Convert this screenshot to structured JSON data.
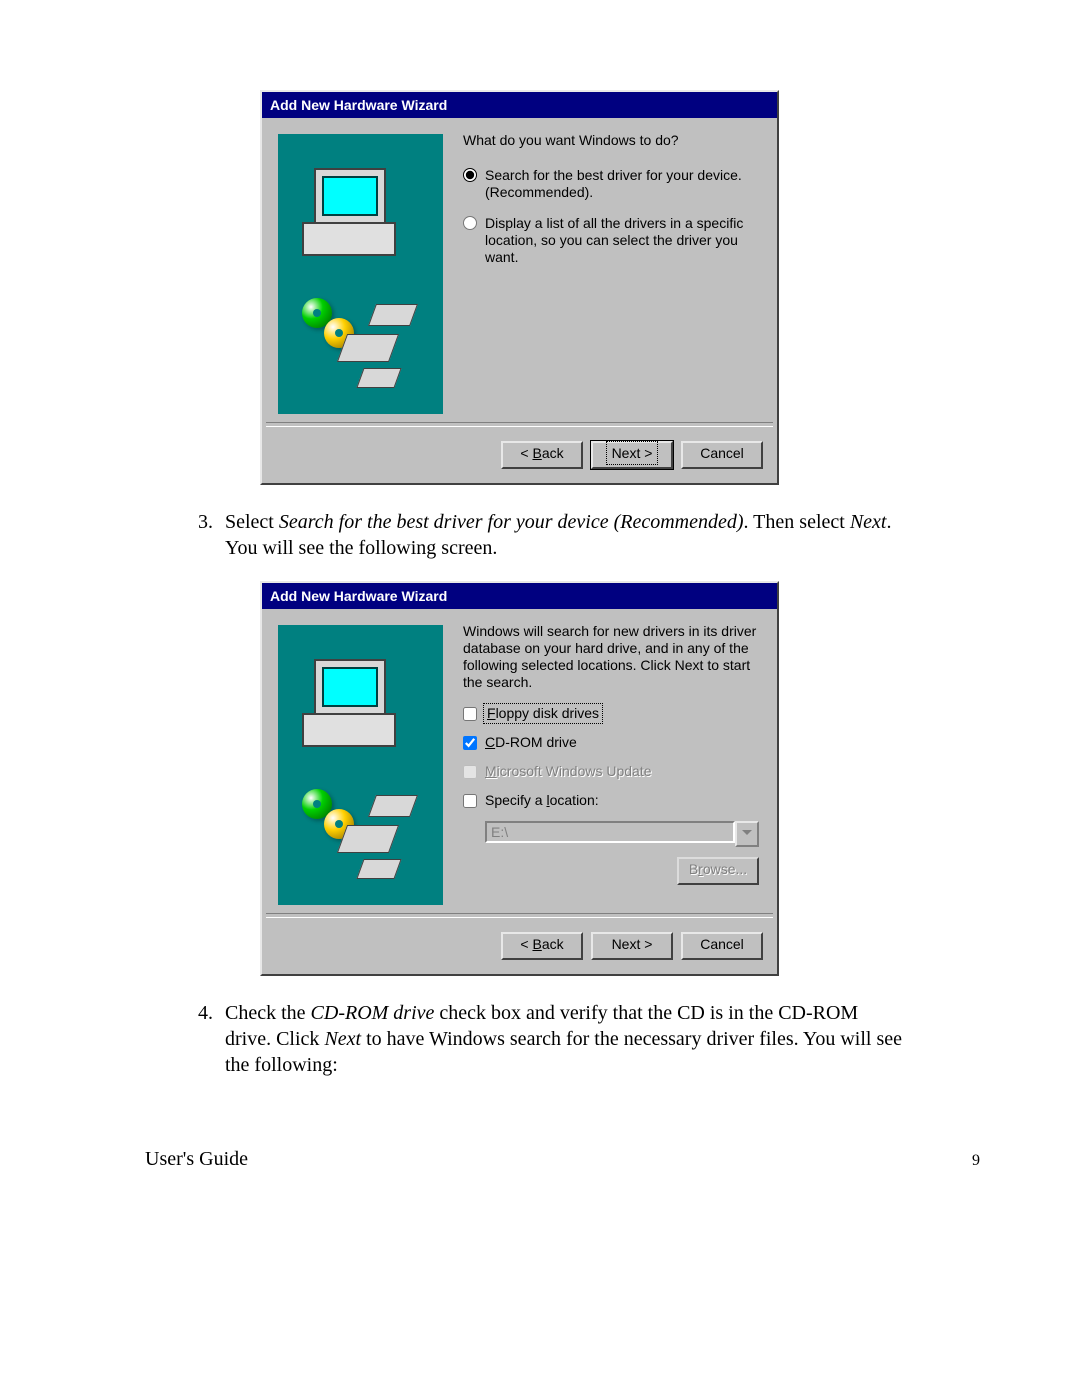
{
  "dialog1": {
    "title": "Add New Hardware Wizard",
    "question": "What do you want Windows to do?",
    "radio_search": "Search for the best driver for your device. (Recommended).",
    "radio_list": "Display a list of all the drivers in a specific location, so you can select the driver you want.",
    "btn_back": "< Back",
    "btn_next": "Next >",
    "btn_cancel": "Cancel"
  },
  "dialog2": {
    "title": "Add New Hardware Wizard",
    "description": "Windows will search for new drivers in its driver database on your hard drive, and in any of the following selected locations. Click Next to start the search.",
    "check_floppy": "Floppy disk drives",
    "check_cdrom": "CD-ROM drive",
    "check_wu": "Microsoft Windows Update",
    "check_location": "Specify a location:",
    "location_value": "E:\\",
    "btn_browse": "Browse...",
    "btn_back": "< Back",
    "btn_next": "Next >",
    "btn_cancel": "Cancel"
  },
  "step3": {
    "num": "3.",
    "prefix": "Select ",
    "italic": "Search for the best driver for your device (Recommended)",
    "mid1": ".  Then select ",
    "next": "Next",
    "suffix": ".  You will see the following screen."
  },
  "step4": {
    "num": "4.",
    "prefix": "Check the ",
    "italic1": "CD-ROM drive",
    "mid1": " check box and verify that the CD is in the CD-ROM drive.  Click ",
    "italic2": "Next",
    "suffix": " to have Windows search for the necessary driver files.  You will see the following:"
  },
  "footer": {
    "left": "User's Guide",
    "page": "9"
  }
}
